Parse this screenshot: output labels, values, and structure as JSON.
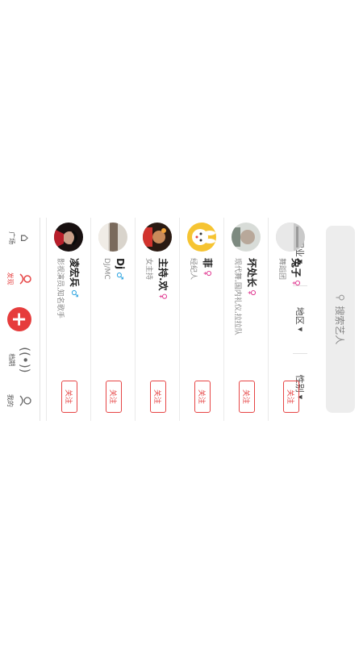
{
  "search": {
    "placeholder": "搜索艺人"
  },
  "filters": [
    {
      "label": "职业"
    },
    {
      "label": "地区"
    },
    {
      "label": "性别"
    }
  ],
  "artists": [
    {
      "name": "兔子",
      "gender": "female",
      "gender_symbol": "♀",
      "desc": "舞蹈团",
      "follow_label": "关注"
    },
    {
      "name": "坏处长",
      "gender": "female",
      "gender_symbol": "♀",
      "desc": "现代舞,国内礼仪,拉拉队",
      "follow_label": "关注"
    },
    {
      "name": "菲",
      "gender": "female",
      "gender_symbol": "♀",
      "desc": "经纪人",
      "follow_label": "关注"
    },
    {
      "name": "主持.欢",
      "gender": "female",
      "gender_symbol": "♀",
      "desc": "女主持",
      "follow_label": "关注"
    },
    {
      "name": "Dj",
      "gender": "male",
      "gender_symbol": "♂",
      "desc": "DJ/MC",
      "follow_label": "关注"
    },
    {
      "name": "凌宏兵",
      "gender": "male",
      "gender_symbol": "♂",
      "desc": "影视演员,知名歌手",
      "follow_label": "关注"
    }
  ],
  "tabbar": [
    {
      "label": "广场",
      "icon": "home-icon"
    },
    {
      "label": "发现",
      "icon": "discover-icon",
      "active": true
    },
    {
      "label": "",
      "icon": "add-icon"
    },
    {
      "label": "档期",
      "icon": "broadcast-icon"
    },
    {
      "label": "我的",
      "icon": "profile-icon"
    }
  ],
  "colors": {
    "accent": "#e64545",
    "female": "#e0368f",
    "male": "#2aa3e0"
  }
}
